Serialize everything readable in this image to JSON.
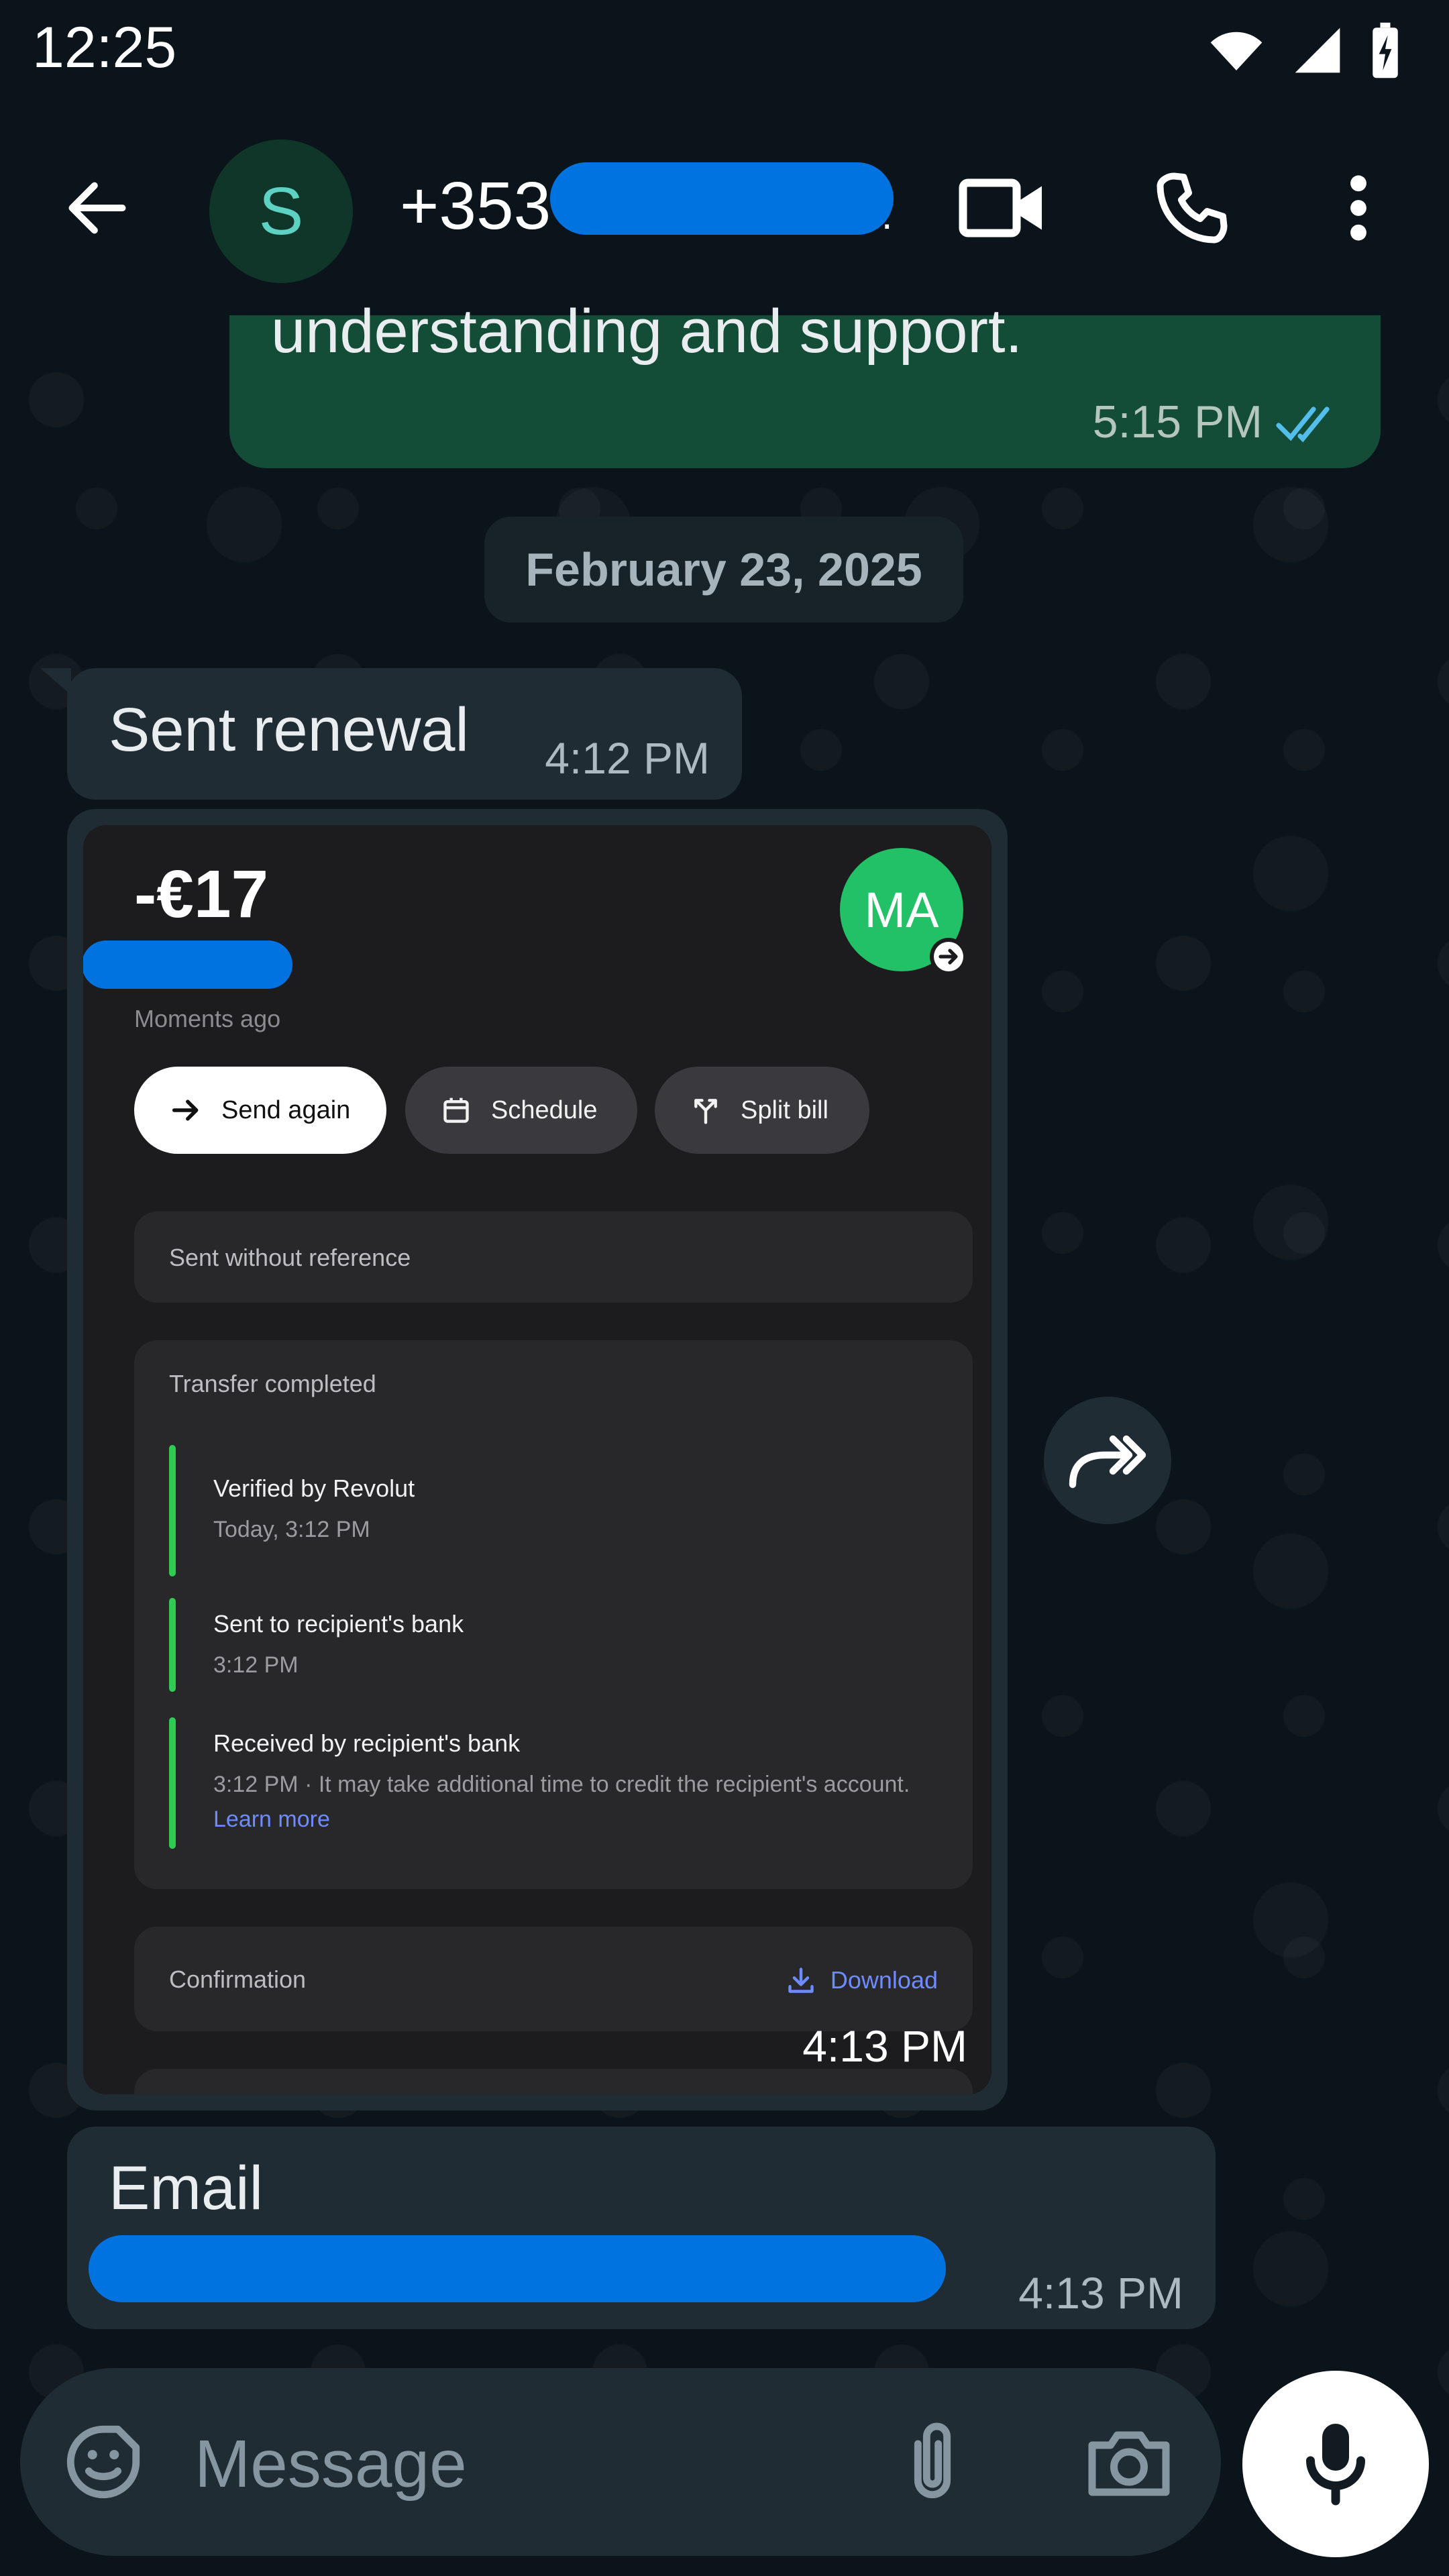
{
  "status_bar": {
    "time": "12:25"
  },
  "header": {
    "avatar_letter": "S",
    "contact_number_prefix": "+353",
    "contact_number_suffix": ".."
  },
  "messages": {
    "outgoing_partial": {
      "text": "understanding and support.",
      "time": "5:15 PM"
    },
    "date_separator": "February 23, 2025",
    "msg_sent_renewal": {
      "text": "Sent renewal",
      "time": "4:12 PM"
    },
    "image_message": {
      "time": "4:13 PM",
      "screenshot": {
        "amount": "-€17",
        "avatar_initials": "MA",
        "timestamp": "Moments ago",
        "actions": [
          "Send again",
          "Schedule",
          "Split bill"
        ],
        "reference": "Sent without reference",
        "status_title": "Transfer completed",
        "steps": [
          {
            "title": "Verified by Revolut",
            "sub": "Today, 3:12 PM"
          },
          {
            "title": "Sent to recipient's bank",
            "sub": "3:12 PM"
          },
          {
            "title": "Received by recipient's bank",
            "sub": "3:12 PM · It may take additional time to credit the recipient's account.",
            "link": "Learn more"
          }
        ],
        "confirmation_label": "Confirmation",
        "download_label": "Download"
      }
    },
    "msg_email": {
      "text": "Email",
      "time": "4:13 PM"
    }
  },
  "composer": {
    "placeholder": "Message"
  },
  "colors": {
    "background": "#0b141a",
    "outgoing_bubble": "#144d37",
    "incoming_bubble": "#1f2c33",
    "read_ticks": "#53bdeb",
    "redaction": "#0073e0",
    "revolut_green": "#2ecc55",
    "link_blue": "#6e8bff"
  },
  "icons": [
    "back-arrow-icon",
    "video-call-icon",
    "phone-icon",
    "more-vert-icon",
    "read-ticks-icon",
    "forward-icon",
    "sticker-icon",
    "attach-icon",
    "camera-icon",
    "mic-icon",
    "wifi-icon",
    "signal-icon",
    "battery-charging-icon"
  ]
}
